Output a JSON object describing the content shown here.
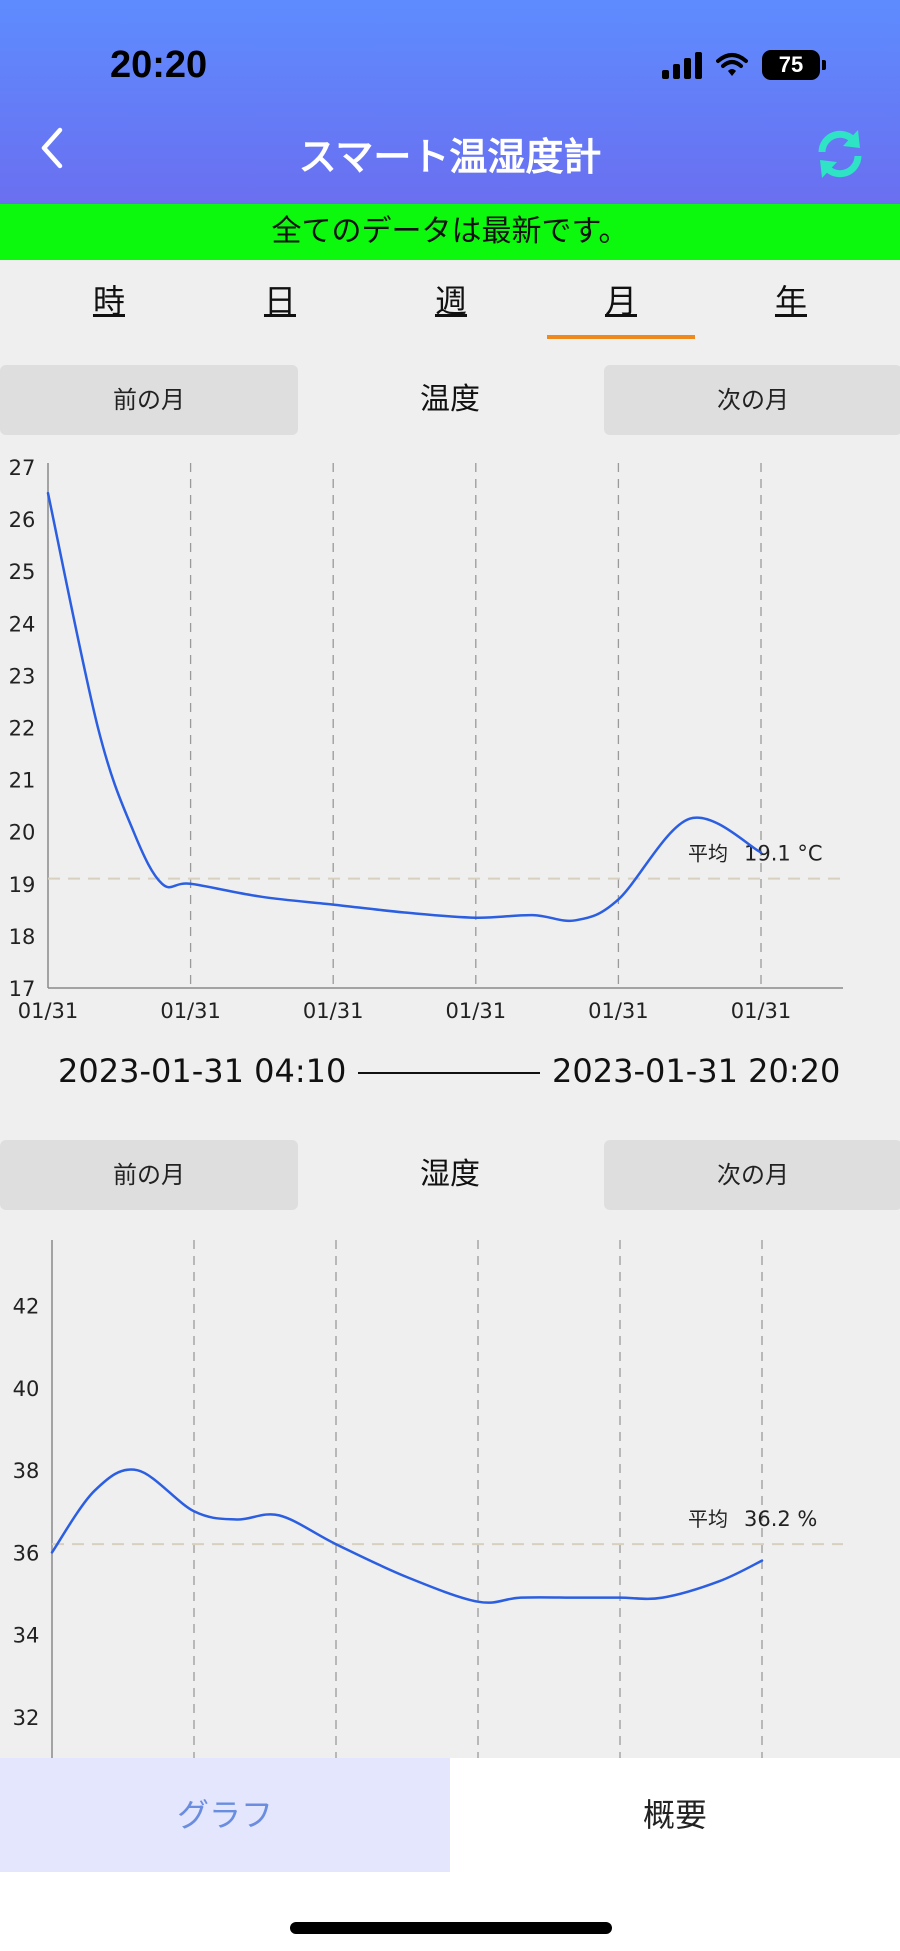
{
  "status": {
    "time": "20:20",
    "battery": "75"
  },
  "nav": {
    "title": "スマート温湿度計",
    "back_icon": "chevron-left-icon",
    "refresh_icon": "refresh-icon"
  },
  "banner": {
    "text": "全てのデータは最新です。",
    "color": "#0cf80c"
  },
  "period_tabs": [
    {
      "label": "時",
      "selected": false
    },
    {
      "label": "日",
      "selected": false
    },
    {
      "label": "週",
      "selected": false
    },
    {
      "label": "月",
      "selected": true
    },
    {
      "label": "年",
      "selected": false
    }
  ],
  "temperature": {
    "prev_label": "前の月",
    "title": "温度",
    "next_label": "次の月"
  },
  "humidity": {
    "prev_label": "前の月",
    "title": "湿度",
    "next_label": "次の月"
  },
  "range": {
    "start": "2023-01-31 04:10",
    "end": "2023-01-31 20:20"
  },
  "bottom_tabs": {
    "graph": "グラフ",
    "overview": "概要"
  },
  "colors": {
    "line": "#2b5ee0",
    "accent": "#f0891c",
    "avg_line": "#d8d0bf"
  },
  "chart_data": [
    {
      "type": "line",
      "title": "温度",
      "x_tick_labels": [
        "01/31",
        "01/31",
        "01/31",
        "01/31",
        "01/31",
        "01/31"
      ],
      "y_ticks": [
        17,
        18,
        19,
        20,
        21,
        22,
        23,
        24,
        25,
        26,
        27
      ],
      "ylim": [
        17,
        27
      ],
      "x": [
        0,
        0.35,
        0.6,
        0.8,
        1.0,
        1.5,
        2.0,
        2.5,
        3.0,
        3.4,
        3.7,
        4.0,
        4.5,
        5.0
      ],
      "values": [
        26.5,
        22.0,
        20.0,
        19.0,
        19.0,
        18.75,
        18.6,
        18.45,
        18.35,
        18.4,
        18.3,
        18.7,
        20.25,
        19.6
      ],
      "average": {
        "label": "平均",
        "value": 19.1,
        "unit": "°C"
      },
      "grid": "vertical dashed",
      "line_color": "#2b5ee0"
    },
    {
      "type": "line",
      "title": "湿度",
      "x_tick_labels": [],
      "y_ticks": [
        32,
        34,
        36,
        38,
        40,
        42
      ],
      "ylim": [
        31,
        43.5
      ],
      "x": [
        0,
        0.3,
        0.6,
        1.0,
        1.3,
        1.6,
        2.0,
        2.5,
        3.0,
        3.3,
        3.7,
        4.0,
        4.3,
        4.7,
        5.0
      ],
      "values": [
        36.0,
        37.5,
        38.0,
        37.0,
        36.8,
        36.9,
        36.2,
        35.4,
        34.8,
        34.9,
        34.9,
        34.9,
        34.9,
        35.3,
        35.8
      ],
      "average": {
        "label": "平均",
        "value": 36.2,
        "unit": "%"
      },
      "grid": "vertical dashed",
      "line_color": "#2b5ee0"
    }
  ]
}
